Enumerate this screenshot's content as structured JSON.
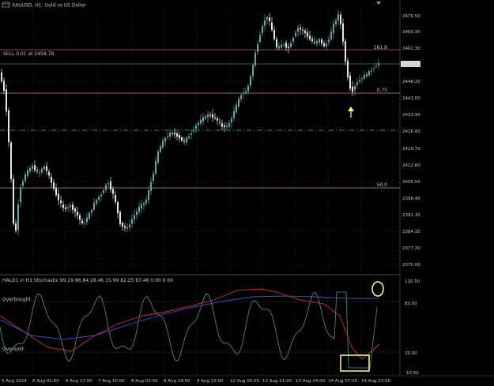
{
  "main": {
    "title": "XAUUSD, H1: Gold vs US Dollar",
    "order_label": "SELL 0.01 at 2458.79",
    "current_price": "2454.89",
    "fib_labels": [
      "161.8",
      "0.75",
      "50.0"
    ],
    "price_ticks": [
      "2476.50",
      "2469.30",
      "2462.30",
      "2455.20",
      "2448.20",
      "2441.00",
      "2433.90",
      "2426.80",
      "2419.70",
      "2412.60",
      "2405.50",
      "2398.40",
      "2391.30",
      "2384.20",
      "2377.20",
      "2370.00"
    ]
  },
  "indicator": {
    "title": "HALD1 in H1 Stochastic 99.29 86.84 28.46 15.99 82.25 87.46 0.00 0.00",
    "overbought_label": "Overbought",
    "oversold_label": "Oversold",
    "ticks": [
      "110.50",
      "80.00",
      "20.00",
      "-10.50"
    ]
  },
  "time_axis": [
    "5 Aug 2024",
    "6 Aug 01:00",
    "6 Aug 17:00",
    "7 Aug 10:00",
    "8 Aug 03:00",
    "8 Aug 19:00",
    "9 Aug 12:00",
    "12 Aug 05:00",
    "12 Aug 21:00",
    "13 Aug 14:00",
    "14 Aug 07:00",
    "14 Aug 23:00"
  ],
  "colors": {
    "background": "#000000",
    "bull_candle": "#5fa8a8",
    "bear_candle": "#e6e6e6",
    "fib_line": "#d08a5a",
    "order_line": "#c8509a",
    "trend_line": "#2e8b57",
    "price_line": "#a0a0a0",
    "stoch_main": "#4a9a8a",
    "stoch_signal": "#d03030",
    "ma_line": "#4a4ad0",
    "annotation": "#ffff80"
  },
  "icons": [
    "window-icon",
    "arrow-up-icon",
    "scroll-marker-icon"
  ]
}
